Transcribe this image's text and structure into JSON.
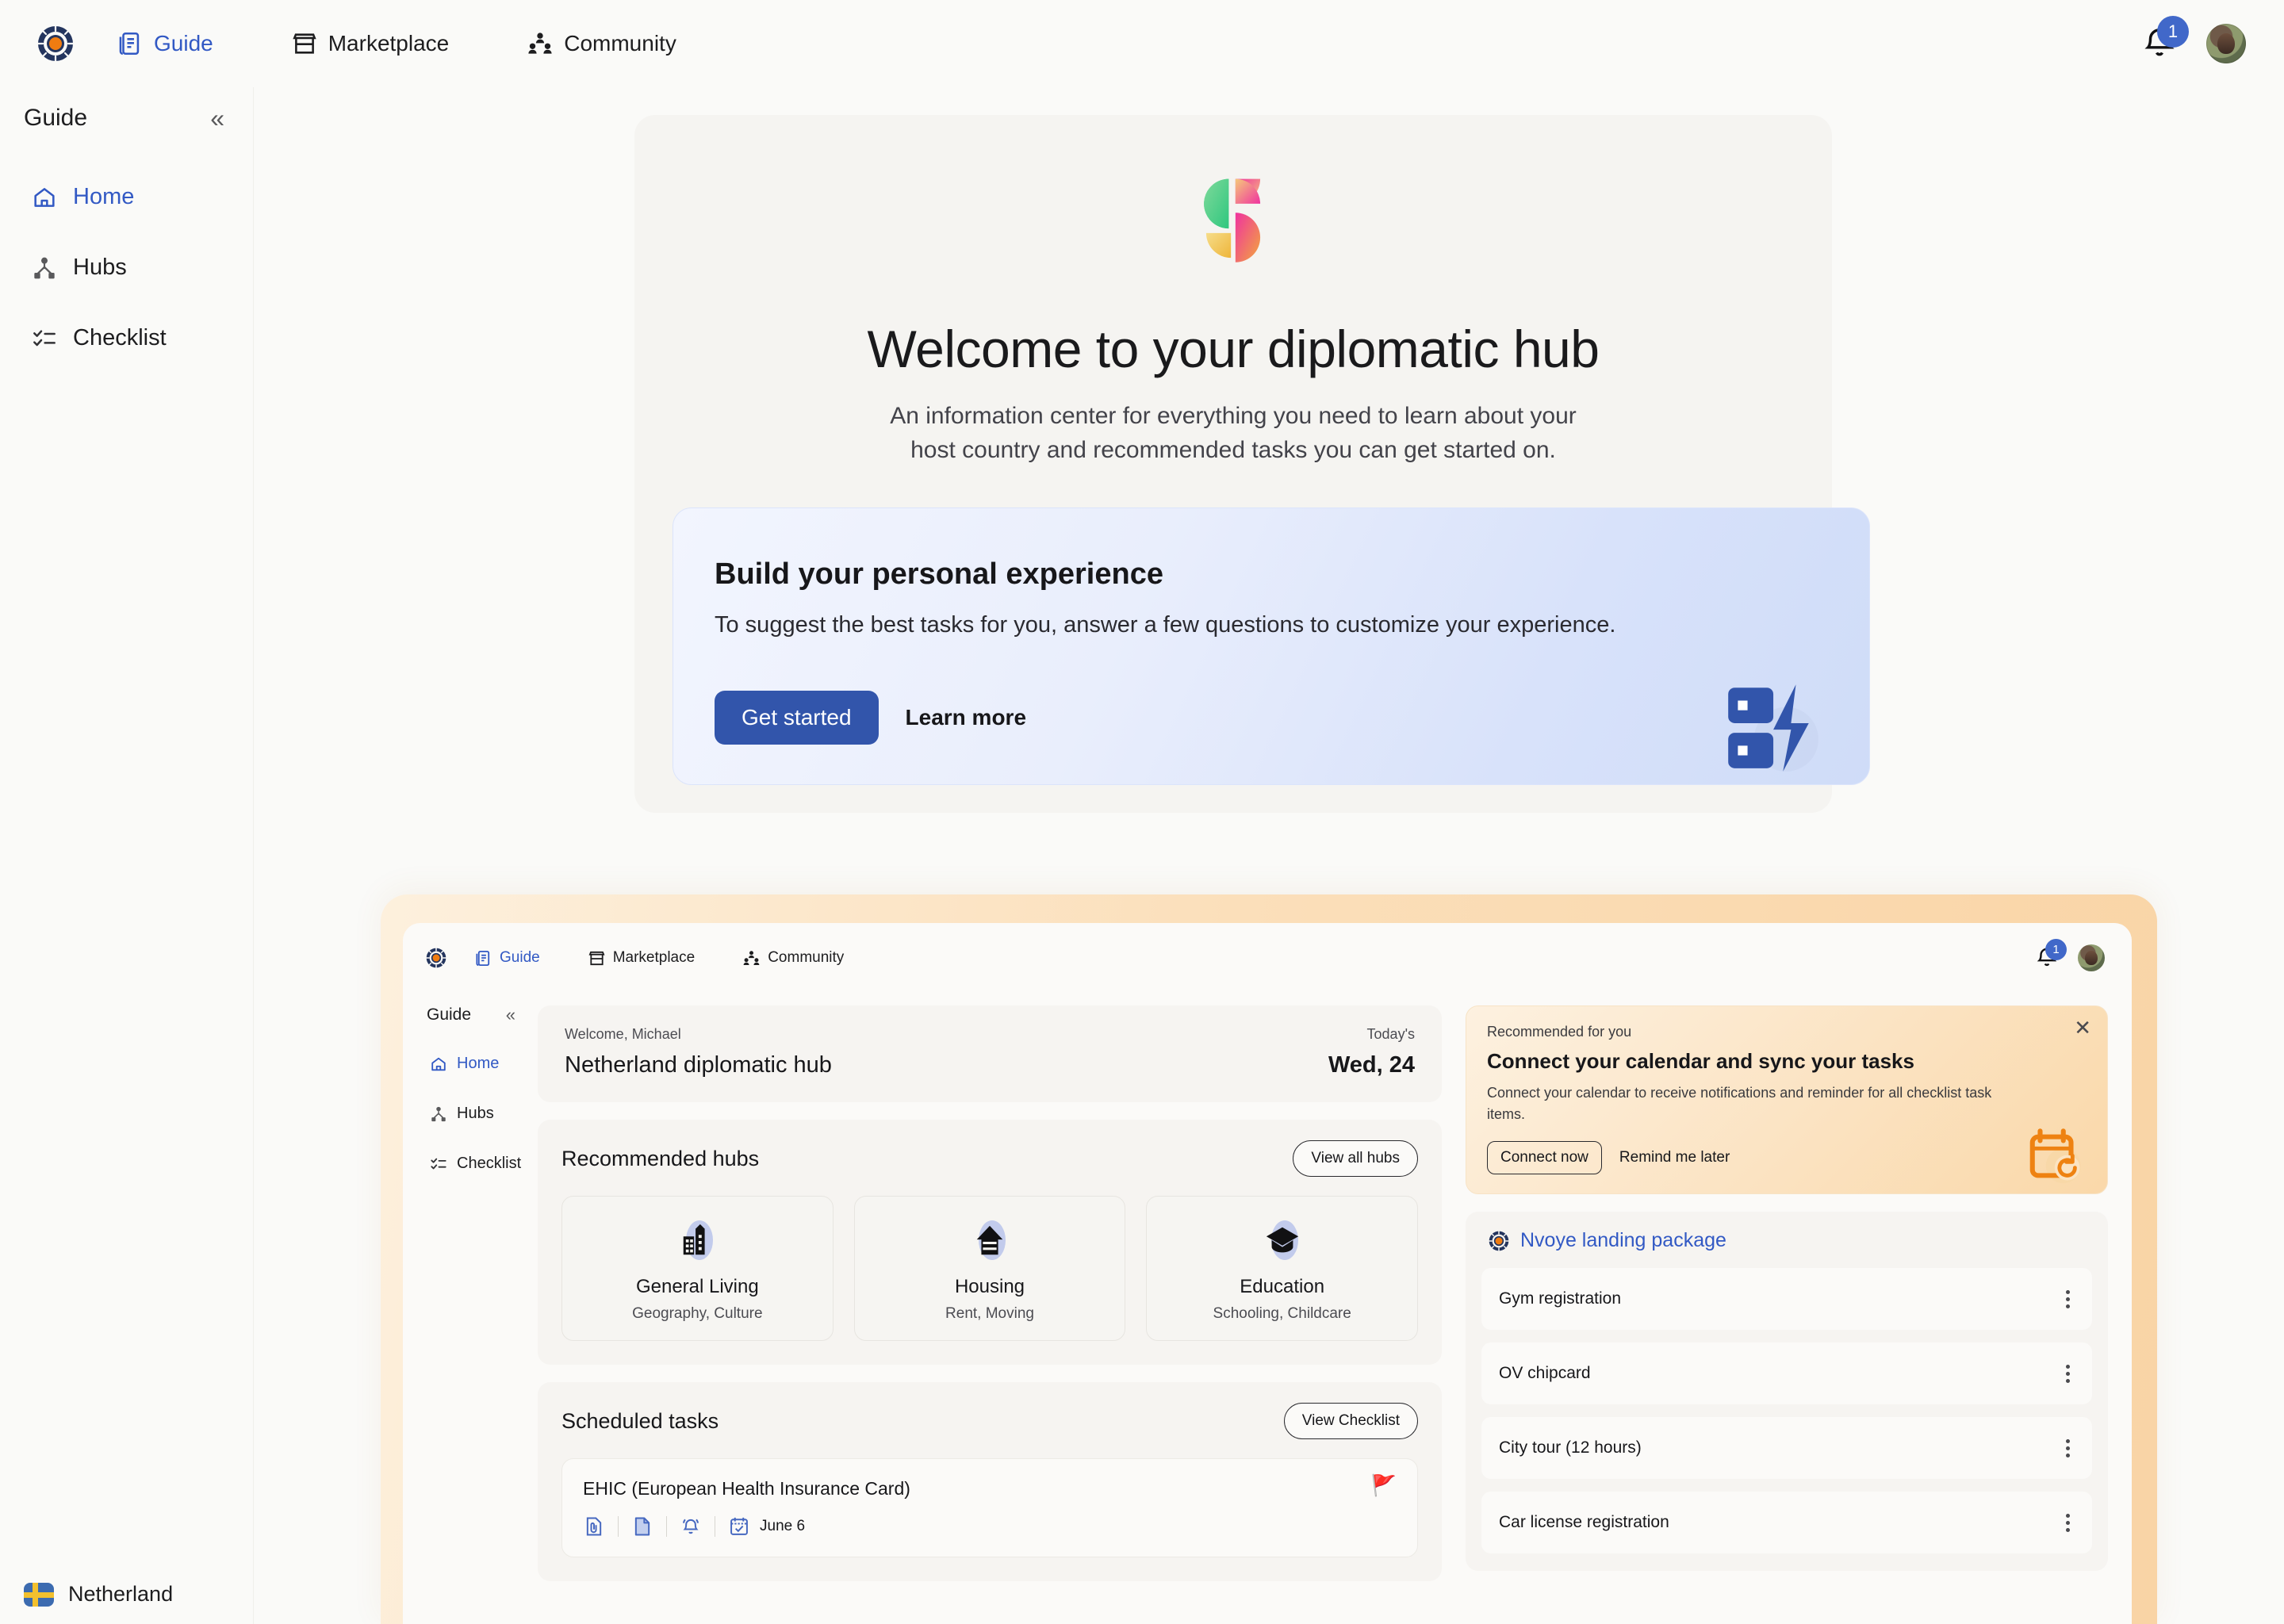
{
  "topnav": {
    "logo_icon": "nvoye-logo-icon",
    "items": [
      {
        "label": "Guide",
        "icon": "guide-book-icon",
        "active": true
      },
      {
        "label": "Marketplace",
        "icon": "storefront-icon",
        "active": false
      },
      {
        "label": "Community",
        "icon": "community-people-icon",
        "active": false
      }
    ],
    "notification_count": "1",
    "bell_icon": "bell-icon",
    "avatar_icon": "user-avatar"
  },
  "sidebar": {
    "title": "Guide",
    "collapse_icon": "chevron-double-left-icon",
    "items": [
      {
        "label": "Home",
        "icon": "home-icon",
        "active": true
      },
      {
        "label": "Hubs",
        "icon": "hubs-network-icon",
        "active": false
      },
      {
        "label": "Checklist",
        "icon": "checklist-icon",
        "active": false
      }
    ],
    "country": "Netherland",
    "flag_icon": "sweden-flag-icon"
  },
  "hero": {
    "logo_icon": "gradient-s-logo",
    "title": "Welcome to your diplomatic hub",
    "subtitle_line1": "An information center for everything you need to learn about your",
    "subtitle_line2": "host country and recommended tasks you can get started on."
  },
  "build_card": {
    "title": "Build your personal experience",
    "description": "To suggest the best tasks for you, answer a few questions to customize your experience.",
    "primary_label": "Get started",
    "secondary_label": "Learn more",
    "art_icon": "dashboard-bolt-icon",
    "accent": "#3255ab"
  },
  "preview": {
    "frame_gradient_start": "#fdf0dd",
    "frame_gradient_end": "#f9d4a5",
    "topnav": {
      "logo_icon": "nvoye-logo-icon",
      "items": [
        {
          "label": "Guide",
          "icon": "guide-book-icon",
          "active": true
        },
        {
          "label": "Marketplace",
          "icon": "storefront-icon",
          "active": false
        },
        {
          "label": "Community",
          "icon": "community-people-icon",
          "active": false
        }
      ],
      "notification_count": "1"
    },
    "sidebar": {
      "title": "Guide",
      "items": [
        {
          "label": "Home",
          "icon": "home-icon",
          "active": true
        },
        {
          "label": "Hubs",
          "icon": "hubs-network-icon",
          "active": false
        },
        {
          "label": "Checklist",
          "icon": "checklist-icon",
          "active": false
        }
      ]
    },
    "welcome_bar": {
      "greeting": "Welcome, Michael",
      "hub_name": "Netherland diplomatic hub",
      "date_label": "Today's",
      "date_value": "Wed, 24"
    },
    "recommended_hubs": {
      "title": "Recommended hubs",
      "action_label": "View all hubs",
      "items": [
        {
          "name": "General Living",
          "sub": "Geography, Culture",
          "icon": "city-buildings-icon"
        },
        {
          "name": "Housing",
          "sub": "Rent, Moving",
          "icon": "house-icon"
        },
        {
          "name": "Education",
          "sub": "Schooling, Childcare",
          "icon": "graduation-cap-icon"
        }
      ]
    },
    "scheduled_tasks": {
      "title": "Scheduled tasks",
      "action_label": "View Checklist",
      "tasks": [
        {
          "title": "EHIC (European Health Insurance Card)",
          "flag": "🚩",
          "date": "June 6",
          "icons": [
            "attachment-file-icon",
            "note-document-icon",
            "reminder-bell-icon",
            "calendar-check-icon"
          ]
        }
      ]
    },
    "promo": {
      "kicker": "Recommended for you",
      "title": "Connect your calendar and sync your tasks",
      "description": "Connect your calendar to receive notifications and reminder for all checklist task items.",
      "primary_label": "Connect now",
      "secondary_label": "Remind me later",
      "close_icon": "close-icon",
      "art_icon": "calendar-sync-icon",
      "accent": "#ee8212"
    },
    "package": {
      "title": "Nvoye landing package",
      "logo_icon": "nvoye-logo-icon",
      "items": [
        {
          "label": "Gym registration",
          "menu_icon": "kebab-menu-icon"
        },
        {
          "label": "OV chipcard",
          "menu_icon": "kebab-menu-icon"
        },
        {
          "label": "City tour (12 hours)",
          "menu_icon": "kebab-menu-icon"
        },
        {
          "label": "Car license registration",
          "menu_icon": "kebab-menu-icon"
        }
      ]
    }
  }
}
